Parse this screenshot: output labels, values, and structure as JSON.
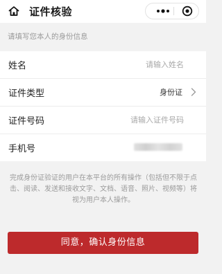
{
  "header": {
    "title": "证件核验"
  },
  "hint": "请填写您本人的身份信息",
  "form": {
    "name": {
      "label": "姓名",
      "placeholder": "请输入姓名"
    },
    "id_type": {
      "label": "证件类型",
      "value": "身份证"
    },
    "id_number": {
      "label": "证件号码",
      "placeholder": "请输入证件号码"
    },
    "phone": {
      "label": "手机号"
    }
  },
  "notice": "完成身份证验证的用户在本平台的所有操作（包括但不限于点击、阅读、发送和接收文字、文档、语音、照片、视频等）将视为用户本人操作。",
  "confirm_button": "同意，确认身份信息",
  "colors": {
    "accent": "#bd2a2c",
    "background": "#f2f2f2"
  },
  "icons": [
    "home-icon",
    "more-icon",
    "target-icon",
    "chevron-right-icon"
  ]
}
